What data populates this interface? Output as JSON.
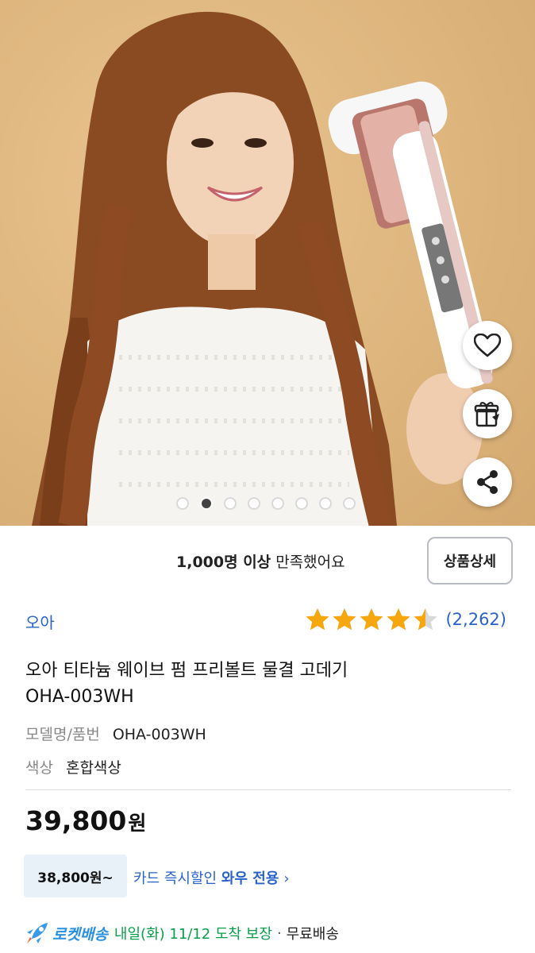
{
  "hero": {
    "carousel": {
      "count": 8,
      "active_index": 1
    },
    "actions": [
      {
        "name": "wishlist-heart-icon"
      },
      {
        "name": "gift-icon"
      },
      {
        "name": "share-icon"
      }
    ]
  },
  "satisfaction": {
    "count_text": "1,000명 이상",
    "suffix": " 만족했어요",
    "detail_button": "상품상세"
  },
  "product": {
    "brand": "오아",
    "rating": 4.5,
    "review_count": "(2,262)",
    "title_line1": "오아 티타늄 웨이브 펌 프리볼트 물결 고데기",
    "title_line2": "OHA-003WH",
    "specs": {
      "model_label": "모델명/품번",
      "model_value": "OHA-003WH",
      "color_label": "색상",
      "color_value": "혼합색상"
    }
  },
  "price": {
    "amount": "39,800",
    "unit": "원",
    "card_price": "38,800원~",
    "card_discount_text": "카드 즉시할인 ",
    "card_discount_bold": "와우 전용",
    "chevron": "›"
  },
  "delivery": {
    "rocket_label": "로켓배송",
    "arrival": "내일(화) 11/12 도착 보장",
    "separator": "·",
    "shipping": "무료배송"
  },
  "colors": {
    "accent_blue": "#2a62c9",
    "star_yellow": "#f7a70e",
    "arrival_green": "#0a9d4a",
    "rocket_blue": "#2a8fe0"
  }
}
